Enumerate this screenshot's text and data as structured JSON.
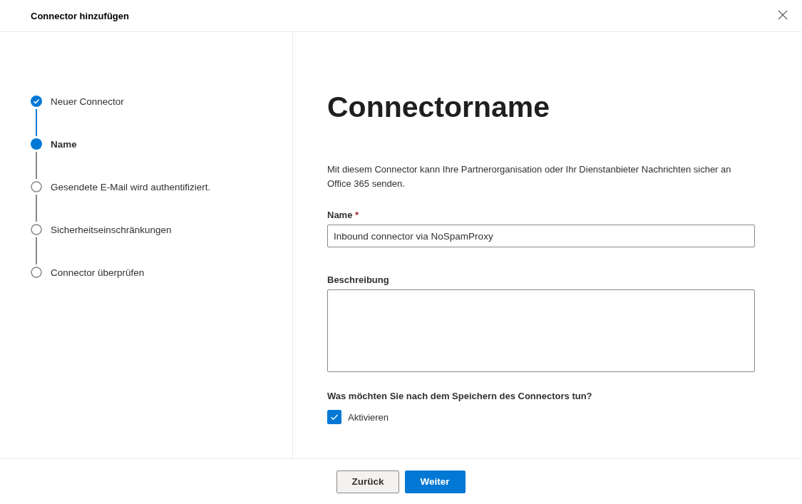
{
  "dialog": {
    "title": "Connector hinzufügen"
  },
  "steps": [
    {
      "label": "Neuer Connector",
      "completed": true,
      "selected": false
    },
    {
      "label": "Name",
      "completed": false,
      "selected": true
    },
    {
      "label": "Gesendete E-Mail wird authentifiziert.",
      "completed": false,
      "selected": false
    },
    {
      "label": "Sicherheitseinschränkungen",
      "completed": false,
      "selected": false
    },
    {
      "label": "Connector überprüfen",
      "completed": false,
      "selected": false
    }
  ],
  "page": {
    "heading": "Connectorname",
    "description": "Mit diesem Connector kann Ihre Partnerorganisation oder Ihr Dienstanbieter Nachrichten sicher an Office 365 senden.",
    "fields": [
      {
        "kind": "input",
        "label": "Name",
        "required_mark": "*",
        "value": "Inbound connector via NoSpamProxy"
      },
      {
        "kind": "textarea",
        "label": "Beschreibung"
      }
    ],
    "question": "Was möchten Sie nach dem Speichern des Connectors tun?",
    "options": [
      {
        "label": "Aktivieren",
        "checked": true
      }
    ]
  },
  "buttons": [
    {
      "label": "Zurück",
      "primary": false
    },
    {
      "label": "Weiter",
      "primary": true
    }
  ]
}
